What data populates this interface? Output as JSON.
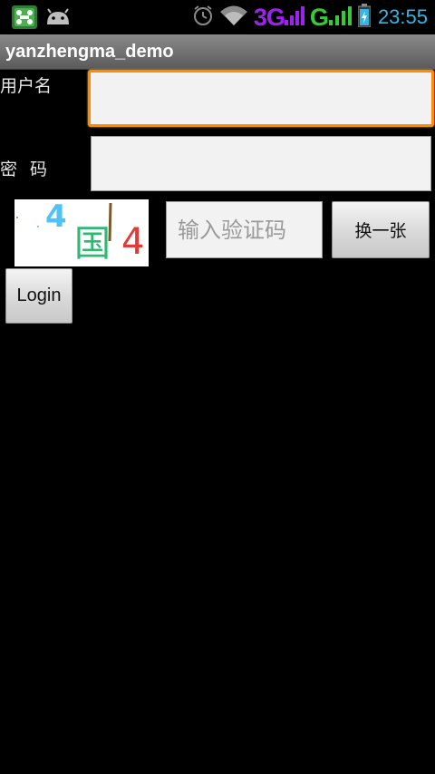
{
  "status_bar": {
    "network_3g": "3G",
    "network_g": "G",
    "time": "23:55",
    "icons": [
      "app-icon",
      "android-icon",
      "alarm-icon",
      "wifi-icon",
      "signal-icon",
      "battery-icon"
    ]
  },
  "app": {
    "title": "yanzhengma_demo"
  },
  "form": {
    "username_label": "用户名",
    "username_value": "",
    "password_label": "密 码",
    "password_value": "",
    "captcha_placeholder": "输入验证码",
    "captcha_image_text": [
      "4",
      "国",
      "4"
    ],
    "refresh_button": "换一张",
    "login_button": "Login"
  },
  "colors": {
    "focus_border": "#ff8c00",
    "clock": "#33b5e5",
    "network_3g": "#a020f0",
    "network_g": "#33cc33"
  }
}
